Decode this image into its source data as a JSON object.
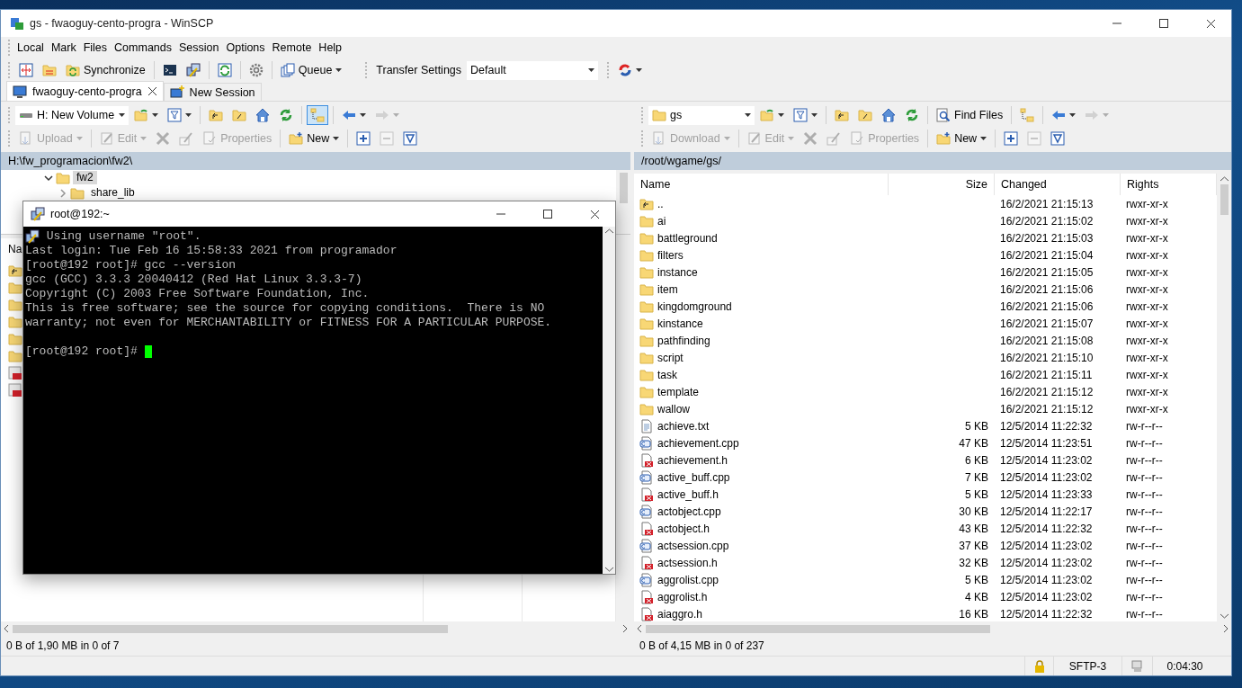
{
  "window": {
    "title": "gs - fwaoguy-cento-progra - WinSCP"
  },
  "menu": [
    "Local",
    "Mark",
    "Files",
    "Commands",
    "Session",
    "Options",
    "Remote",
    "Help"
  ],
  "main_toolbar": {
    "synchronize": "Synchronize",
    "queue": "Queue",
    "transfer_settings_label": "Transfer Settings",
    "transfer_settings_value": "Default"
  },
  "tabs": [
    {
      "label": "fwaoguy-cento-progra",
      "selected": true
    },
    {
      "label": "New Session",
      "selected": false
    }
  ],
  "left_panel": {
    "location": "H: New Volume",
    "tree_toggle_on": true,
    "actions": [
      {
        "label": "Upload",
        "disabled": true
      },
      {
        "label": "Edit",
        "disabled": true
      },
      {
        "label": "Properties",
        "disabled": true
      },
      {
        "label": "New",
        "disabled": false
      }
    ],
    "path": "H:\\fw_programacion\\fw2\\",
    "tree": [
      {
        "label": "fw2",
        "expanded": true,
        "selected": true,
        "children": [
          {
            "label": "share_lib",
            "expanded": false,
            "selected": false
          }
        ]
      }
    ],
    "list_header": "Na",
    "items": [
      {
        "kind": "parent"
      },
      {
        "kind": "folder"
      },
      {
        "kind": "folder"
      },
      {
        "kind": "folder"
      },
      {
        "kind": "folder"
      },
      {
        "kind": "folder"
      },
      {
        "kind": "program"
      },
      {
        "kind": "program"
      }
    ],
    "status": "0 B of 1,90 MB in 0 of 7"
  },
  "right_panel": {
    "location": "gs",
    "find_files": "Find Files",
    "tree_toggle_on": false,
    "actions": [
      {
        "label": "Download",
        "disabled": true
      },
      {
        "label": "Edit",
        "disabled": true
      },
      {
        "label": "Properties",
        "disabled": true
      },
      {
        "label": "New",
        "disabled": false
      }
    ],
    "path": "/root/wgame/gs/",
    "columns": [
      "Name",
      "Size",
      "Changed",
      "Rights"
    ],
    "rows": [
      {
        "kind": "parent",
        "name": "..",
        "size": "",
        "changed": "16/2/2021 21:15:13",
        "rights": "rwxr-xr-x"
      },
      {
        "kind": "folder",
        "name": "ai",
        "size": "",
        "changed": "16/2/2021 21:15:02",
        "rights": "rwxr-xr-x"
      },
      {
        "kind": "folder",
        "name": "battleground",
        "size": "",
        "changed": "16/2/2021 21:15:03",
        "rights": "rwxr-xr-x"
      },
      {
        "kind": "folder",
        "name": "filters",
        "size": "",
        "changed": "16/2/2021 21:15:04",
        "rights": "rwxr-xr-x"
      },
      {
        "kind": "folder",
        "name": "instance",
        "size": "",
        "changed": "16/2/2021 21:15:05",
        "rights": "rwxr-xr-x"
      },
      {
        "kind": "folder",
        "name": "item",
        "size": "",
        "changed": "16/2/2021 21:15:06",
        "rights": "rwxr-xr-x"
      },
      {
        "kind": "folder",
        "name": "kingdomground",
        "size": "",
        "changed": "16/2/2021 21:15:06",
        "rights": "rwxr-xr-x"
      },
      {
        "kind": "folder",
        "name": "kinstance",
        "size": "",
        "changed": "16/2/2021 21:15:07",
        "rights": "rwxr-xr-x"
      },
      {
        "kind": "folder",
        "name": "pathfinding",
        "size": "",
        "changed": "16/2/2021 21:15:08",
        "rights": "rwxr-xr-x"
      },
      {
        "kind": "folder",
        "name": "script",
        "size": "",
        "changed": "16/2/2021 21:15:10",
        "rights": "rwxr-xr-x"
      },
      {
        "kind": "folder",
        "name": "task",
        "size": "",
        "changed": "16/2/2021 21:15:11",
        "rights": "rwxr-xr-x"
      },
      {
        "kind": "folder",
        "name": "template",
        "size": "",
        "changed": "16/2/2021 21:15:12",
        "rights": "rwxr-xr-x"
      },
      {
        "kind": "folder",
        "name": "wallow",
        "size": "",
        "changed": "16/2/2021 21:15:12",
        "rights": "rwxr-xr-x"
      },
      {
        "kind": "text",
        "name": "achieve.txt",
        "size": "5 KB",
        "changed": "12/5/2014 11:22:32",
        "rights": "rw-r--r--"
      },
      {
        "kind": "cpp",
        "name": "achievement.cpp",
        "size": "47 KB",
        "changed": "12/5/2014 11:23:51",
        "rights": "rw-r--r--"
      },
      {
        "kind": "header",
        "name": "achievement.h",
        "size": "6 KB",
        "changed": "12/5/2014 11:23:02",
        "rights": "rw-r--r--"
      },
      {
        "kind": "cpp",
        "name": "active_buff.cpp",
        "size": "7 KB",
        "changed": "12/5/2014 11:23:02",
        "rights": "rw-r--r--"
      },
      {
        "kind": "header",
        "name": "active_buff.h",
        "size": "5 KB",
        "changed": "12/5/2014 11:23:33",
        "rights": "rw-r--r--"
      },
      {
        "kind": "cpp",
        "name": "actobject.cpp",
        "size": "30 KB",
        "changed": "12/5/2014 11:22:17",
        "rights": "rw-r--r--"
      },
      {
        "kind": "header",
        "name": "actobject.h",
        "size": "43 KB",
        "changed": "12/5/2014 11:22:32",
        "rights": "rw-r--r--"
      },
      {
        "kind": "cpp",
        "name": "actsession.cpp",
        "size": "37 KB",
        "changed": "12/5/2014 11:23:02",
        "rights": "rw-r--r--"
      },
      {
        "kind": "header",
        "name": "actsession.h",
        "size": "32 KB",
        "changed": "12/5/2014 11:23:02",
        "rights": "rw-r--r--"
      },
      {
        "kind": "cpp",
        "name": "aggrolist.cpp",
        "size": "5 KB",
        "changed": "12/5/2014 11:23:02",
        "rights": "rw-r--r--"
      },
      {
        "kind": "header",
        "name": "aggrolist.h",
        "size": "4 KB",
        "changed": "12/5/2014 11:23:02",
        "rights": "rw-r--r--"
      },
      {
        "kind": "header",
        "name": "aiaggro.h",
        "size": "16 KB",
        "changed": "12/5/2014 11:22:32",
        "rights": "rw-r--r--"
      }
    ],
    "status": "0 B of 4,15 MB in 0 of 237"
  },
  "status_bar": {
    "protocol": "SFTP-3",
    "elapsed": "0:04:30"
  },
  "terminal": {
    "title": "root@192:~",
    "lines": [
      {
        "kind": "info",
        "text": "Using username \"root\"."
      },
      {
        "kind": "output",
        "text": "Last login: Tue Feb 16 15:58:33 2021 from programador"
      },
      {
        "kind": "output",
        "text": "[root@192 root]# gcc --version"
      },
      {
        "kind": "output",
        "text": "gcc (GCC) 3.3.3 20040412 (Red Hat Linux 3.3.3-7)"
      },
      {
        "kind": "output",
        "text": "Copyright (C) 2003 Free Software Foundation, Inc."
      },
      {
        "kind": "output",
        "text": "This is free software; see the source for copying conditions.  There is NO"
      },
      {
        "kind": "output",
        "text": "warranty; not even for MERCHANTABILITY or FITNESS FOR A PARTICULAR PURPOSE."
      },
      {
        "kind": "blank"
      },
      {
        "kind": "prompt",
        "text": "[root@192 root]# "
      }
    ]
  }
}
